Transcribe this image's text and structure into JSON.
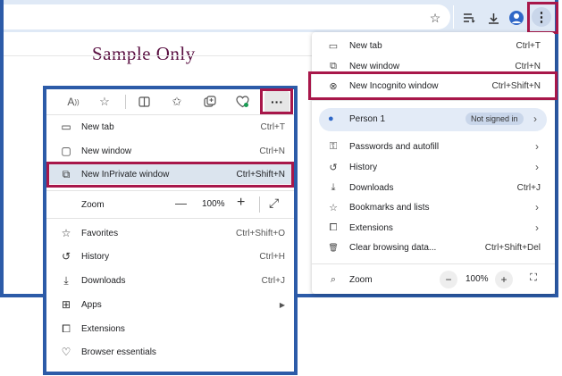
{
  "watermark": "Sample Only",
  "chrome_toolbar": {
    "icons": [
      "star-icon",
      "reading-list-icon",
      "download-icon",
      "profile-icon",
      "more-vert-icon"
    ],
    "star": "☆",
    "more": "⋮"
  },
  "chrome_menu": {
    "items": [
      {
        "label": "New tab",
        "shortcut": "Ctrl+T",
        "icon": "▭"
      },
      {
        "label": "New window",
        "shortcut": "Ctrl+N",
        "icon": "⧉"
      },
      {
        "label": "New Incognito window",
        "shortcut": "Ctrl+Shift+N",
        "icon": "⊗"
      },
      {
        "label": "Person 1",
        "badge": "Not signed in",
        "icon": "●"
      },
      {
        "label": "Passwords and autofill",
        "icon": "⚿"
      },
      {
        "label": "History",
        "icon": "↺"
      },
      {
        "label": "Downloads",
        "shortcut": "Ctrl+J",
        "icon": "⤓"
      },
      {
        "label": "Bookmarks and lists",
        "icon": "☆"
      },
      {
        "label": "Extensions",
        "icon": "⧠"
      },
      {
        "label": "Clear browsing data...",
        "shortcut": "Ctrl+Shift+Del",
        "icon": "🗑"
      },
      {
        "label": "Zoom",
        "value": "100%",
        "icon": "⌕"
      }
    ],
    "zoom_minus": "−",
    "zoom_plus": "+",
    "fullscreen": "⛶"
  },
  "edge_menu": {
    "items": [
      {
        "label": "New tab",
        "shortcut": "Ctrl+T",
        "icon": "▭"
      },
      {
        "label": "New window",
        "shortcut": "Ctrl+N",
        "icon": "▢"
      },
      {
        "label": "New InPrivate window",
        "shortcut": "Ctrl+Shift+N",
        "icon": "⧉"
      },
      {
        "label": "Zoom",
        "value": "100%",
        "icon": ""
      },
      {
        "label": "Favorites",
        "shortcut": "Ctrl+Shift+O",
        "icon": "☆"
      },
      {
        "label": "History",
        "shortcut": "Ctrl+H",
        "icon": "↺"
      },
      {
        "label": "Downloads",
        "shortcut": "Ctrl+J",
        "icon": "⤓"
      },
      {
        "label": "Apps",
        "icon": "⊞"
      },
      {
        "label": "Extensions",
        "icon": "⧠"
      },
      {
        "label": "Browser essentials",
        "icon": "♡"
      }
    ],
    "zoom_minus": "—",
    "zoom_plus": "+",
    "expand": "⤢",
    "more": "···"
  },
  "arrow": "›",
  "colors": {
    "frame": "#2c5ba8",
    "highlight": "#a8174a",
    "watermark": "#5a1042"
  }
}
